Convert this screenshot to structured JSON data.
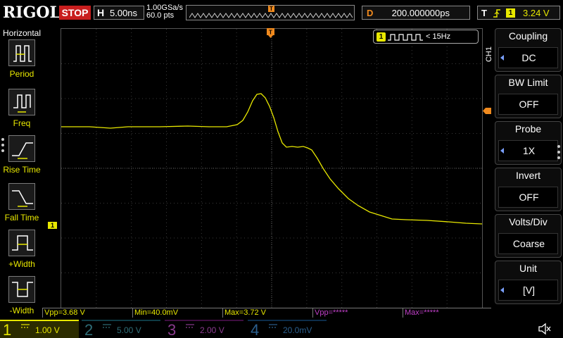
{
  "brand": "RIGOL",
  "run_state": "STOP",
  "horizontal": {
    "letter": "H",
    "timebase": "5.00ns",
    "sample_rate": "1.00GSa/s",
    "points": "60.0 pts"
  },
  "trigger_pos_marker": "T",
  "delay": {
    "letter": "D",
    "value": "200.000000ps"
  },
  "trigger": {
    "letter": "T",
    "source": "1",
    "level": "3.24 V",
    "edge_icon": "rising-edge-icon"
  },
  "left_panel": {
    "title": "Horizontal",
    "items": [
      {
        "label": "Period",
        "icon": "period-icon"
      },
      {
        "label": "Freq",
        "icon": "freq-icon"
      },
      {
        "label": "Rise Time",
        "icon": "rise-time-icon"
      },
      {
        "label": "Fall Time",
        "icon": "fall-time-icon"
      },
      {
        "label": "+Width",
        "icon": "pos-width-icon"
      },
      {
        "label": "-Width",
        "icon": "neg-width-icon"
      }
    ]
  },
  "freq_counter": {
    "channel": "1",
    "value": "< 15Hz"
  },
  "channel_tag": "CH1",
  "ch1_offset_marker": "1",
  "menu": [
    {
      "label": "Coupling",
      "value": "DC"
    },
    {
      "label": "BW Limit",
      "value": "OFF"
    },
    {
      "label": "Probe",
      "value": "1X"
    },
    {
      "label": "Invert",
      "value": "OFF"
    },
    {
      "label": "Volts/Div",
      "value": "Coarse"
    },
    {
      "label": "Unit",
      "value": "[V]"
    }
  ],
  "measurements": [
    {
      "text": "Vpp=3.68 V"
    },
    {
      "text": "Min=40.0mV"
    },
    {
      "text": "Max=3.72 V"
    },
    {
      "text": "Vpp=*****"
    },
    {
      "text": "Max=*****"
    }
  ],
  "channels": [
    {
      "num": "1",
      "scale": "1.00 V"
    },
    {
      "num": "2",
      "scale": "5.00 V"
    },
    {
      "num": "3",
      "scale": "2.00 V"
    },
    {
      "num": "4",
      "scale": "20.0mV"
    }
  ],
  "colors": {
    "ch1": "#e8e800",
    "trigger": "#f08a1e",
    "stop": "#c81e1e",
    "ch3": "#c040c8"
  }
}
